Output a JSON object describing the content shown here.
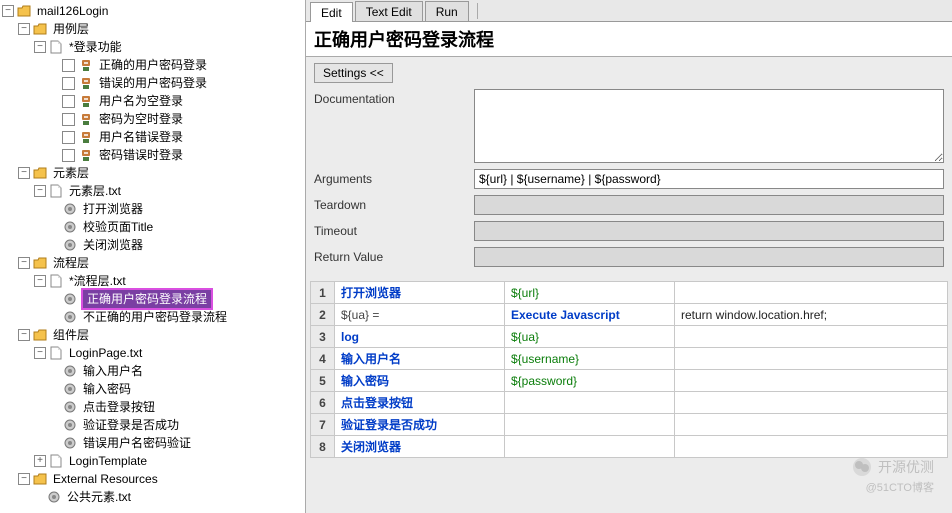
{
  "tree": {
    "root": "mail126Login",
    "layer1": "用例层",
    "loginFunc": "*登录功能",
    "cases": [
      "正确的用户密码登录",
      "错误的用户密码登录",
      "用户名为空登录",
      "密码为空时登录",
      "用户名错误登录",
      "密码错误时登录"
    ],
    "layer2": "元素层",
    "elemFile": "元素层.txt",
    "elemKw": [
      "打开浏览器",
      "校验页面Title",
      "关闭浏览器"
    ],
    "layer3": "流程层",
    "flowFile": "*流程层.txt",
    "flowKw": [
      "正确用户密码登录流程",
      "不正确的用户密码登录流程"
    ],
    "layer4": "组件层",
    "loginPage": "LoginPage.txt",
    "loginKw": [
      "输入用户名",
      "输入密码",
      "点击登录按钮",
      "验证登录是否成功",
      "错误用户名密码验证"
    ],
    "loginTpl": "LoginTemplate",
    "extRes": "External Resources",
    "pubElem": "公共元素.txt"
  },
  "tabs": {
    "edit": "Edit",
    "textEdit": "Text Edit",
    "run": "Run"
  },
  "title": "正确用户密码登录流程",
  "settingsBtn": "Settings <<",
  "form": {
    "doc": "Documentation",
    "args": "Arguments",
    "argsVal": "${url} | ${username} | ${password}",
    "teardown": "Teardown",
    "timeout": "Timeout",
    "retval": "Return Value"
  },
  "steps": [
    {
      "n": "1",
      "a": "打开浏览器",
      "b": "${url}",
      "c": "",
      "akw": true,
      "bval": true
    },
    {
      "n": "2",
      "a": "${ua} =",
      "b": "Execute Javascript",
      "c": "return window.location.href;",
      "akw": false,
      "bkw": true
    },
    {
      "n": "3",
      "a": "log",
      "b": "${ua}",
      "c": "",
      "akw": true,
      "bval": true
    },
    {
      "n": "4",
      "a": "输入用户名",
      "b": "${username}",
      "c": "",
      "akw": true,
      "bval": true
    },
    {
      "n": "5",
      "a": "输入密码",
      "b": "${password}",
      "c": "",
      "akw": true,
      "bval": true
    },
    {
      "n": "6",
      "a": "点击登录按钮",
      "b": "",
      "c": "",
      "akw": true
    },
    {
      "n": "7",
      "a": "验证登录是否成功",
      "b": "",
      "c": "",
      "akw": true
    },
    {
      "n": "8",
      "a": "关闭浏览器",
      "b": "",
      "c": "",
      "akw": true
    }
  ],
  "watermark": {
    "main": "开源优测",
    "sub": "@51CTO博客"
  }
}
